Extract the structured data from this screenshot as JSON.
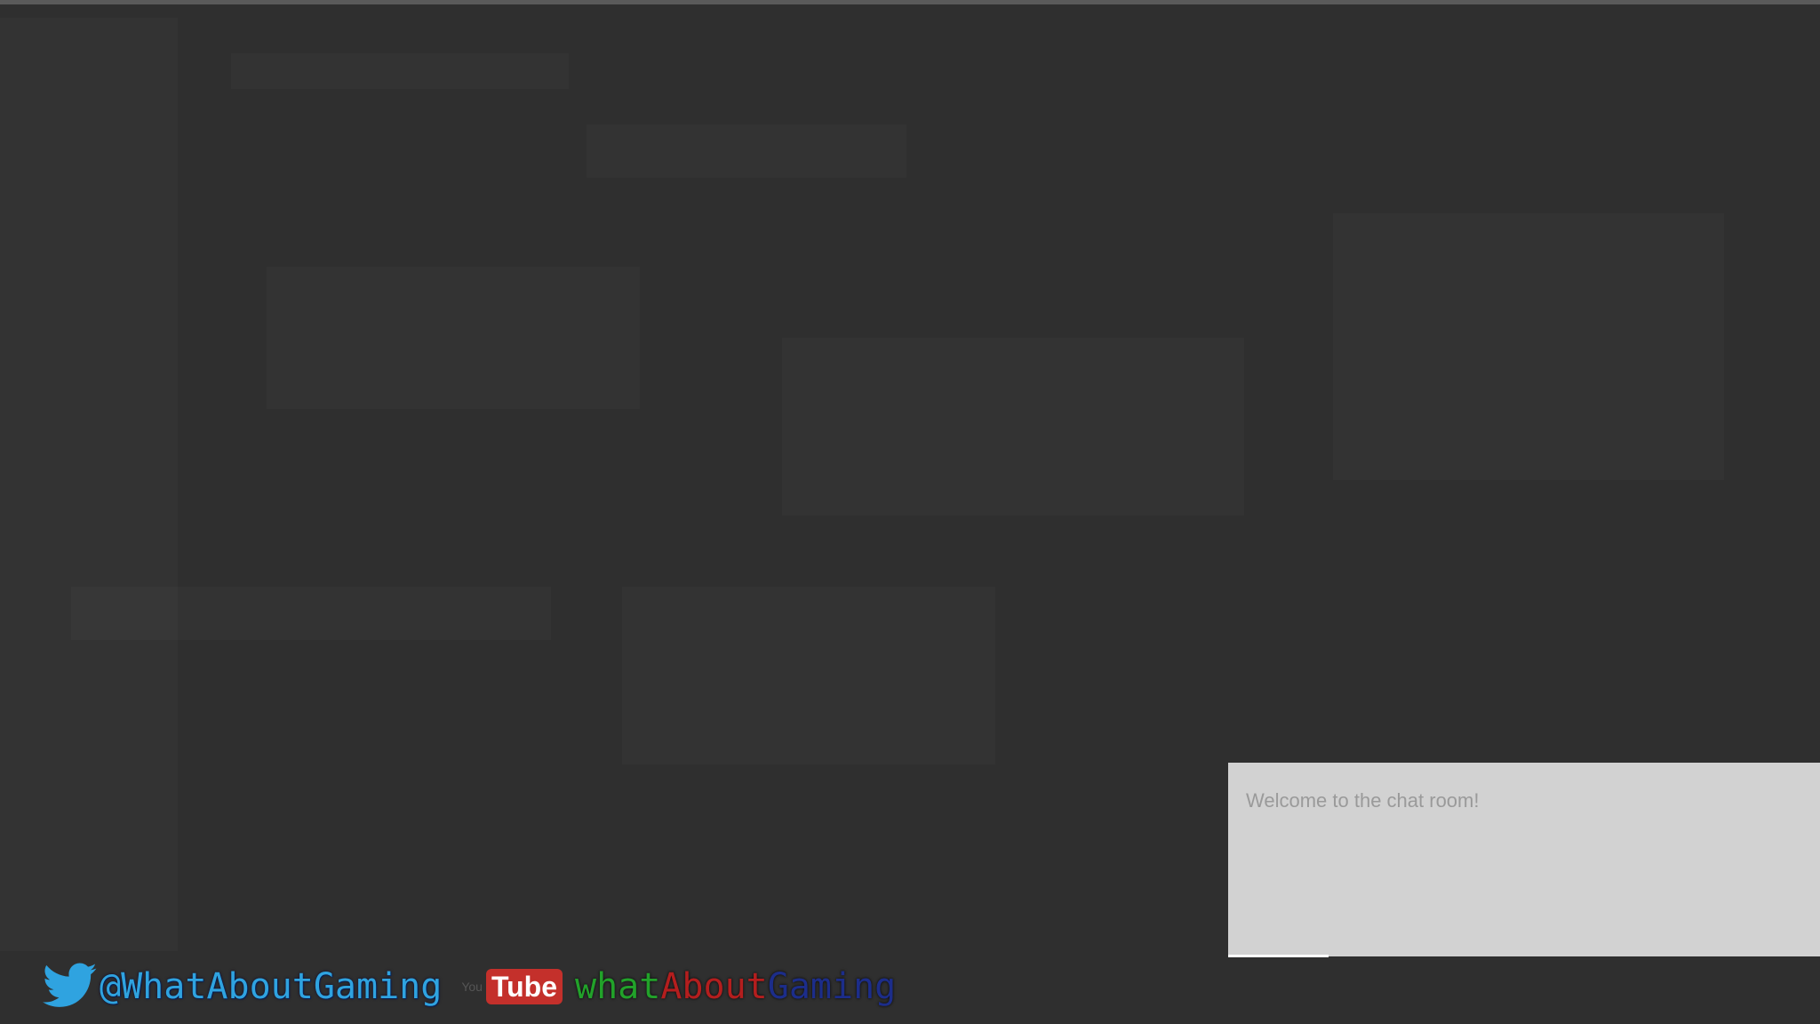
{
  "chat": {
    "welcome_message": "Welcome to the chat room!"
  },
  "social": {
    "twitter_handle": "@WhatAboutGaming",
    "youtube_small_label": "You",
    "youtube_logo_text": "Tube",
    "youtube_channel_parts": [
      "what",
      "About",
      "Gaming"
    ]
  },
  "colors": {
    "background": "#2f2f2f",
    "chat_panel": "#d2d2d2",
    "twitter_blue": "#2fa3e0",
    "youtube_red": "#c4302b",
    "channel_green": "#22a22a",
    "channel_red": "#b41e1e",
    "channel_blue": "#1c2d8a"
  },
  "icons": {
    "twitter": "twitter-bird-icon",
    "youtube": "youtube-logo-icon"
  }
}
